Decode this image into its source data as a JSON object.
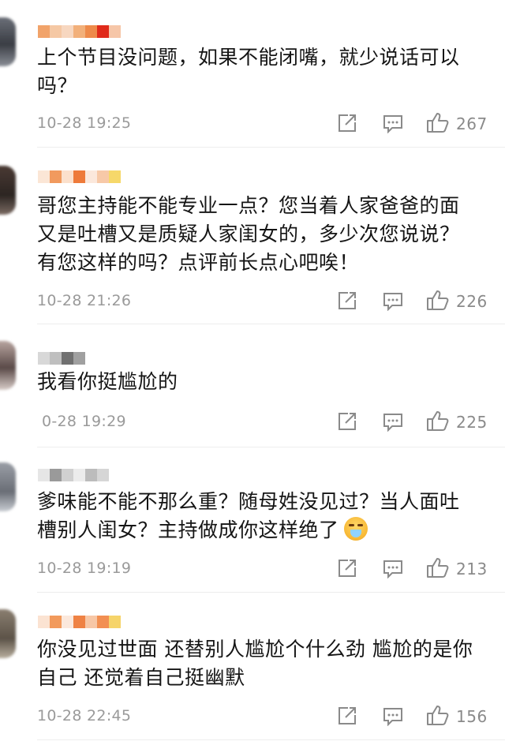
{
  "comments": [
    {
      "text": "上个节目没问题，如果不能闭嘴，就少说话可以\n吗？",
      "time": "10-28 19:25",
      "likes": "267",
      "username_pixels": [
        "#f1a36a",
        "#f5c8a4",
        "#f7d7c0",
        "#f2b07a",
        "#ee8a4a",
        "#e02a1a",
        "#f6c6a8"
      ]
    },
    {
      "text": "哥您主持能不能专业一点？您当着人家爸爸的面\n又是吐槽又是质疑人家闺女的，多少次您说说？\n有您这样的吗？点评前长点心吧唉！",
      "time": "10-28 21:26",
      "likes": "226",
      "username_pixels": [
        "#fbe6d6",
        "#f19a5e",
        "#fbe0cc",
        "#ee7a3a",
        "#fbe8dc",
        "#f7c9a8",
        "#f6d86a"
      ]
    },
    {
      "text": "我看你挺尴尬的",
      "time": "0-28 19:29",
      "likes": "225",
      "username_pixels": [
        "#d8d8d8",
        "#bfbfbf",
        "#707070",
        "#a0a0a0"
      ]
    },
    {
      "text": "爹味能不能不那么重？随母姓没见过？当人面吐\n槽别人闺女？主持做成你这样绝了",
      "time": "10-28 19:19",
      "likes": "213",
      "username_pixels": [
        "#e6e6e6",
        "#9a9a9a",
        "#d0d0d0",
        "#ececec",
        "#bcbcbc",
        "#d6d6d6"
      ]
    },
    {
      "text": "你没见过世面 还替别人尴尬个什么劲 尴尬的是你\n自己 还觉着自己挺幽默",
      "time": "10-28 22:45",
      "likes": "156",
      "username_pixels": [
        "#fbe3d2",
        "#f29a5c",
        "#fbe8dc",
        "#ef8244",
        "#f7c7a6",
        "#f28f52",
        "#f6d46a"
      ]
    }
  ],
  "icons": {
    "share": "share-icon",
    "reply": "comment-icon",
    "like": "thumbs-up-icon"
  },
  "colors": {
    "text": "#151515",
    "meta": "#9a9a9a",
    "divider": "#ededed"
  }
}
